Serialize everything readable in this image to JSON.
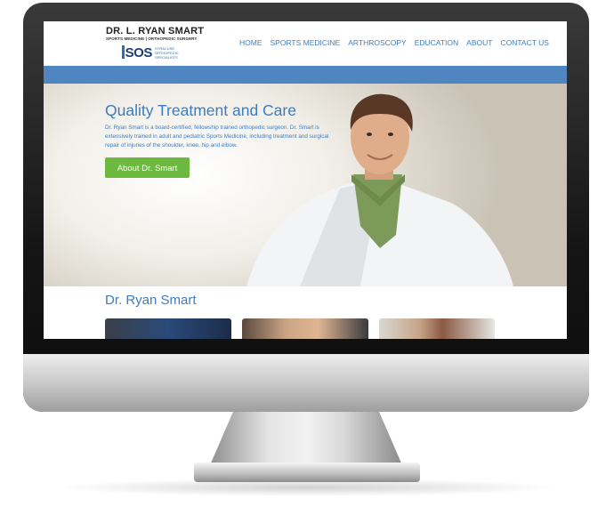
{
  "site": {
    "logo_name": "DR. L. RYAN SMART",
    "logo_subtitle": "SPORTS MEDICINE | ORTHOPEDIC SURGERY",
    "logo_sos": "SOS",
    "logo_sos_text": "SYRACUSE ORTHOPEDIC SPECIALISTS"
  },
  "nav": {
    "items": [
      {
        "label": "HOME"
      },
      {
        "label": "SPORTS MEDICINE"
      },
      {
        "label": "ARTHROSCOPY"
      },
      {
        "label": "EDUCATION"
      },
      {
        "label": "ABOUT"
      },
      {
        "label": "CONTACT US"
      }
    ]
  },
  "hero": {
    "title": "Quality Treatment and Care",
    "text": "Dr. Ryan Smart is a board-certified, fellowship trained orthopedic surgeon. Dr. Smart is extensively trained in adult and pediatric Sports Medicine, including treatment and surgical repair of injuries of the shoulder, knee, hip and elbow.",
    "button_label": "About Dr. Smart"
  },
  "section": {
    "title": "Dr. Ryan Smart"
  },
  "colors": {
    "accent_blue": "#3d7cc0",
    "band_blue": "#4f86c2",
    "button_green": "#6db83e"
  }
}
